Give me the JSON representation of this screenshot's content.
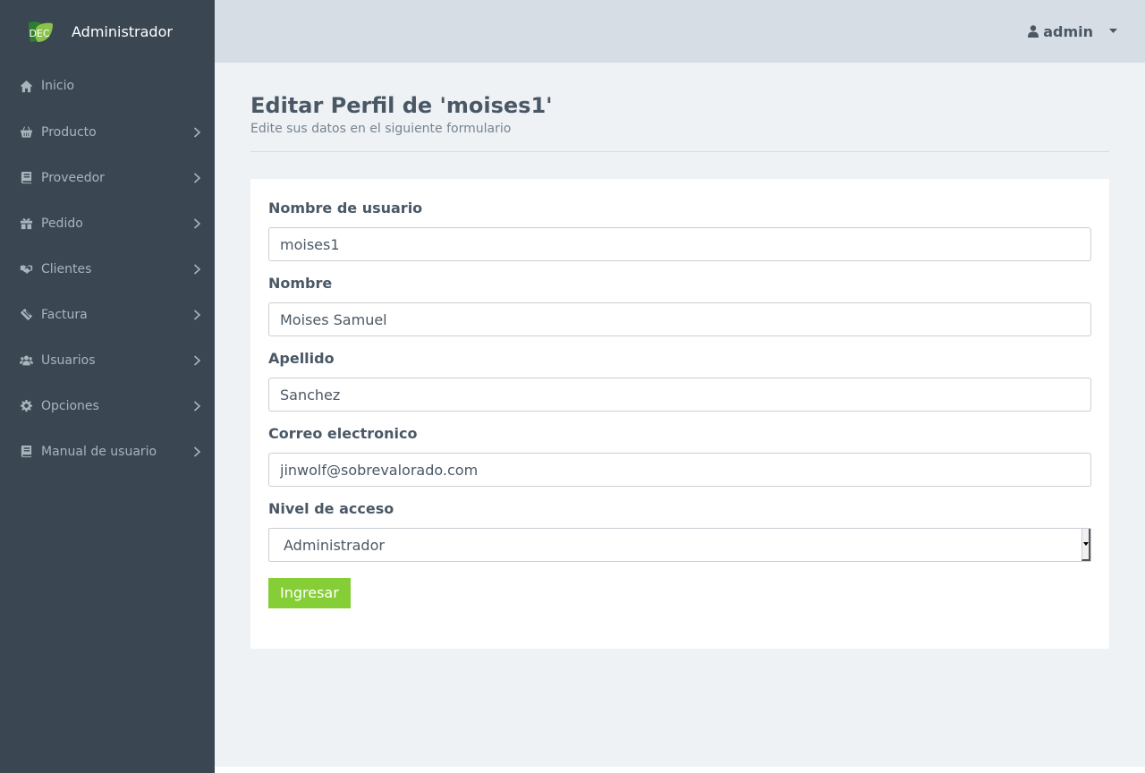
{
  "brand": {
    "logo_text": "DEC",
    "title": "Administrador"
  },
  "sidebar": {
    "items": [
      {
        "label": "Inicio",
        "icon": "home-icon",
        "has_submenu": false
      },
      {
        "label": "Producto",
        "icon": "basket-icon",
        "has_submenu": true
      },
      {
        "label": "Proveedor",
        "icon": "book-icon",
        "has_submenu": true
      },
      {
        "label": "Pedido",
        "icon": "gift-icon",
        "has_submenu": true
      },
      {
        "label": "Clientes",
        "icon": "handshake-icon",
        "has_submenu": true
      },
      {
        "label": "Factura",
        "icon": "ticket-icon",
        "has_submenu": true
      },
      {
        "label": "Usuarios",
        "icon": "users-icon",
        "has_submenu": true
      },
      {
        "label": "Opciones",
        "icon": "gear-icon",
        "has_submenu": true
      },
      {
        "label": "Manual de usuario",
        "icon": "book-icon",
        "has_submenu": true
      }
    ]
  },
  "topbar": {
    "user_name": "admin"
  },
  "page": {
    "title": "Editar Perfil de 'moises1'",
    "subtitle": "Edite sus datos en el siguiente formulario"
  },
  "form": {
    "username_label": "Nombre de usuario",
    "username_value": "moises1",
    "name_label": "Nombre",
    "name_value": "Moises Samuel",
    "lastname_label": "Apellido",
    "lastname_value": "Sanchez",
    "email_label": "Correo electronico",
    "email_value": "jinwolf@sobrevalorado.com",
    "access_label": "Nivel de acceso",
    "access_value": "Administrador",
    "submit_label": "Ingresar"
  },
  "colors": {
    "sidebar_bg": "#3a4651",
    "topbar_bg": "#d7dde4",
    "accent": "#85ce36",
    "text": "#4a5866"
  }
}
